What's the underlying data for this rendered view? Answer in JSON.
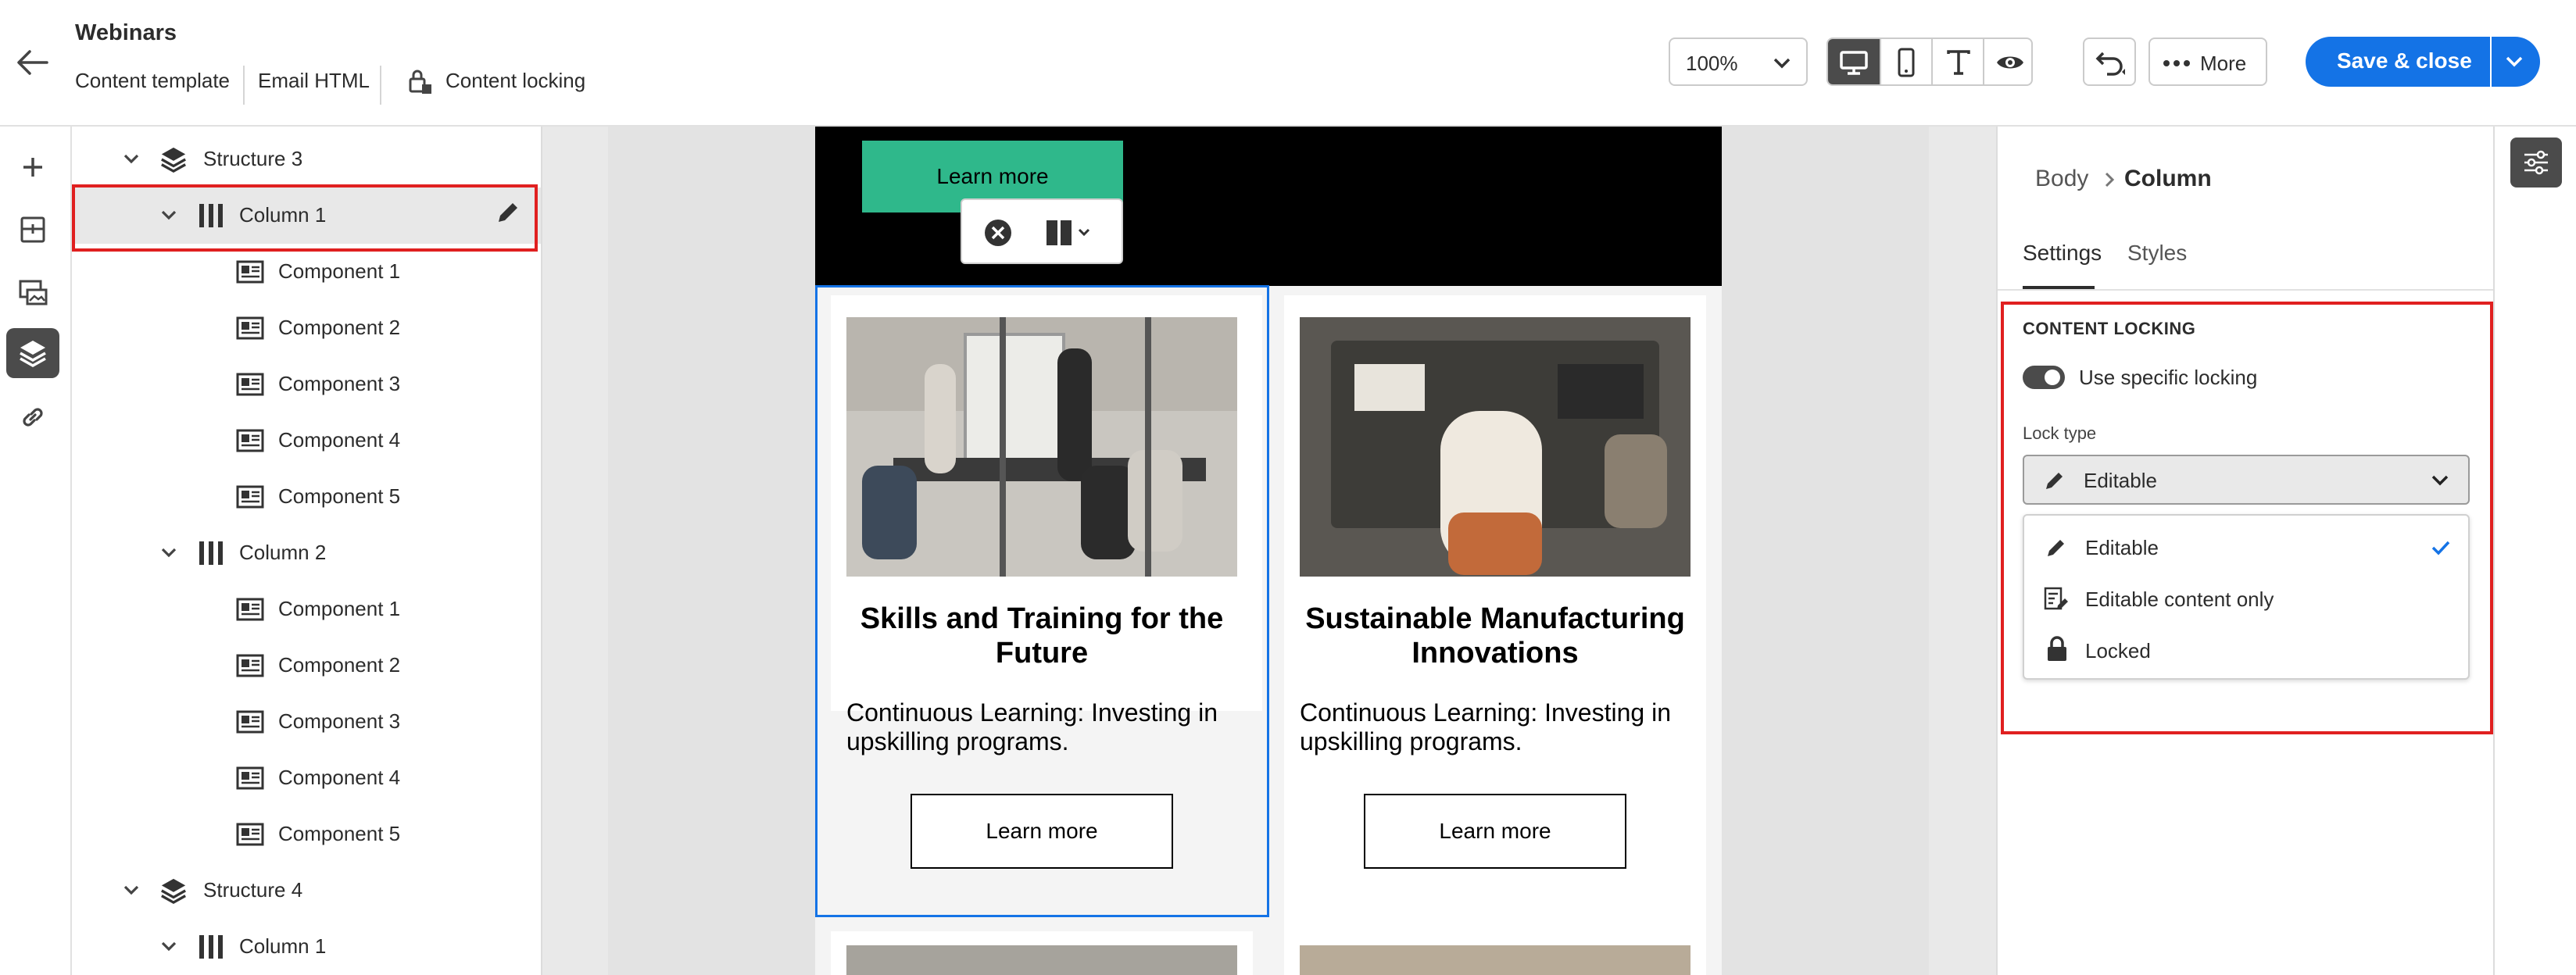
{
  "header": {
    "title": "Webinars",
    "tabs": [
      "Content template",
      "Email HTML",
      "Content locking"
    ],
    "zoom": "100%",
    "more_label": "More",
    "save_label": "Save & close"
  },
  "rail": {
    "icons": [
      "add-icon",
      "structure-icon",
      "fragments-icon",
      "layers-icon",
      "link-icon"
    ]
  },
  "tree": {
    "rows": [
      {
        "type": "structure",
        "label": "Structure 3"
      },
      {
        "type": "column",
        "label": "Column 1",
        "selected": true
      },
      {
        "type": "component",
        "label": "Component 1"
      },
      {
        "type": "component",
        "label": "Component 2"
      },
      {
        "type": "component",
        "label": "Component 3"
      },
      {
        "type": "component",
        "label": "Component 4"
      },
      {
        "type": "component",
        "label": "Component 5"
      },
      {
        "type": "column",
        "label": "Column 2"
      },
      {
        "type": "component",
        "label": "Component 1"
      },
      {
        "type": "component",
        "label": "Component 2"
      },
      {
        "type": "component",
        "label": "Component 3"
      },
      {
        "type": "component",
        "label": "Component 4"
      },
      {
        "type": "component",
        "label": "Component 5"
      },
      {
        "type": "structure",
        "label": "Structure 4"
      },
      {
        "type": "column",
        "label": "Column 1"
      }
    ]
  },
  "email": {
    "top_button": "Learn more",
    "cards": [
      {
        "title": "Skills and Training for the Future",
        "body": "Continuous Learning: Investing in upskilling programs.",
        "button": "Learn more"
      },
      {
        "title": "Sustainable Manufacturing Innovations",
        "body": "Continuous Learning: Investing in upskilling programs.",
        "button": "Learn more"
      }
    ]
  },
  "panel": {
    "breadcrumb_parent": "Body",
    "breadcrumb_current": "Column",
    "tab_settings": "Settings",
    "tab_styles": "Styles",
    "section_title": "CONTENT LOCKING",
    "toggle_label": "Use specific locking",
    "lock_type_label": "Lock type",
    "lock_type_value": "Editable",
    "options": [
      "Editable",
      "Editable content only",
      "Locked"
    ]
  },
  "colors": {
    "accent": "#1473e6",
    "highlight": "#e02020",
    "learn_more_green": "#2fb88b"
  }
}
